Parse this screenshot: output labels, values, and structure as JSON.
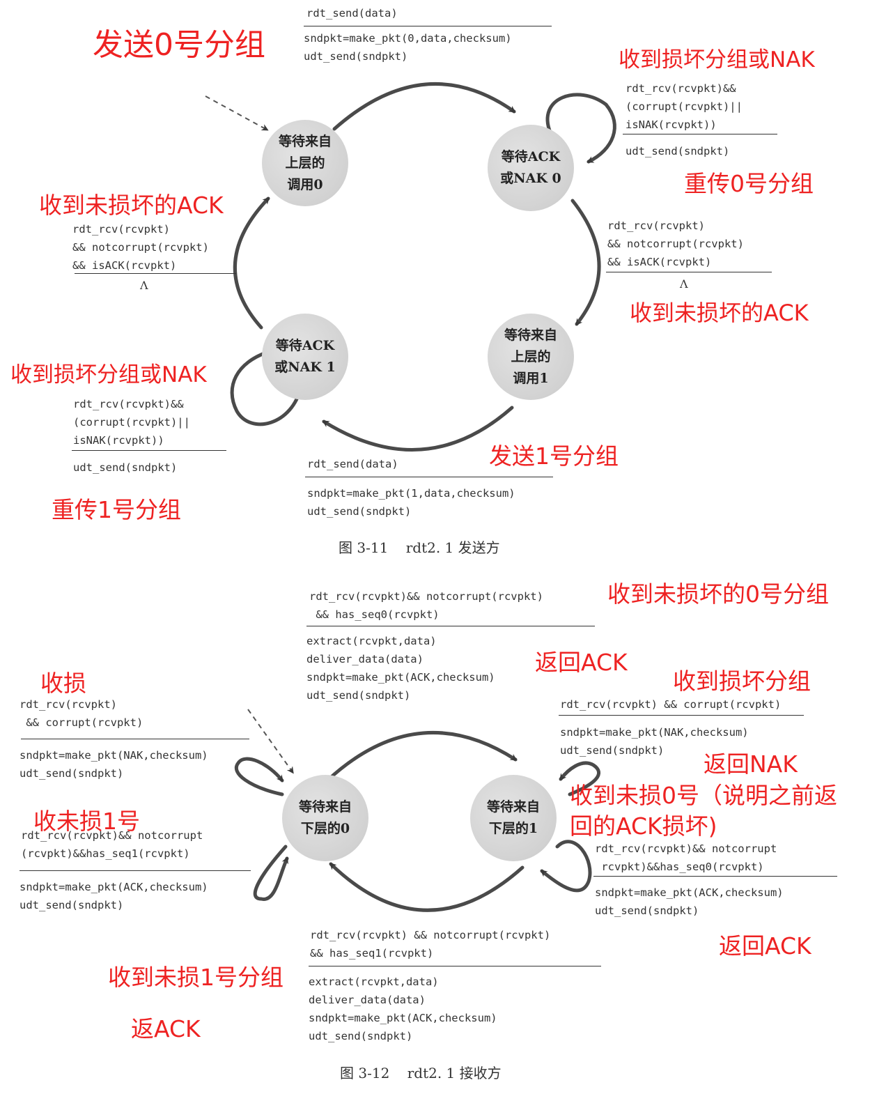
{
  "sender": {
    "caption": "图 3-11    rdt2. 1 发送方",
    "states": {
      "wait_call_0": "等待来自\n上层的\n调用0",
      "wait_ack_0": "等待ACK\n或NAK 0",
      "wait_call_1": "等待来自\n上层的\n调用1",
      "wait_ack_1": "等待ACK\n或NAK 1"
    },
    "transitions": {
      "send0": {
        "event": "rdt_send(data)",
        "actions": "sndpkt=make_pkt(0,data,checksum)\nudt_send(sndpkt)"
      },
      "resend0": {
        "event": "rdt_rcv(rcvpkt)&&\n(corrupt(rcvpkt)||\nisNAK(rcvpkt))",
        "actions": "udt_send(sndpkt)"
      },
      "ack0": {
        "event": "rdt_rcv(rcvpkt)\n&& notcorrupt(rcvpkt)\n&& isACK(rcvpkt)",
        "actions": "Λ"
      },
      "send1": {
        "event": "rdt_send(data)",
        "actions": "sndpkt=make_pkt(1,data,checksum)\nudt_send(sndpkt)"
      },
      "resend1": {
        "event": "rdt_rcv(rcvpkt)&&\n(corrupt(rcvpkt)||\nisNAK(rcvpkt))",
        "actions": "udt_send(sndpkt)"
      },
      "ack1": {
        "event": "rdt_rcv(rcvpkt)\n&& notcorrupt(rcvpkt)\n&& isACK(rcvpkt)",
        "actions": "Λ"
      }
    },
    "notes": {
      "send0": "发送0号分组",
      "corrupt_nak_top": "收到损坏分组或NAK",
      "resend0": "重传0号分组",
      "ack_left": "收到未损坏的ACK",
      "ack_right": "收到未损坏的ACK",
      "corrupt_nak_left": "收到损坏分组或NAK",
      "send1": "发送1号分组",
      "resend1": "重传1号分组"
    }
  },
  "receiver": {
    "caption": "图 3-12    rdt2. 1 接收方",
    "states": {
      "wait_below_0": "等待来自\n下层的0",
      "wait_below_1": "等待来自\n下层的1"
    },
    "transitions": {
      "top": {
        "event": "rdt_rcv(rcvpkt)&& notcorrupt(rcvpkt)\n && has_seq0(rcvpkt)",
        "actions": "extract(rcvpkt,data)\ndeliver_data(data)\nsndpkt=make_pkt(ACK,checksum)\nudt_send(sndpkt)"
      },
      "left_corrupt": {
        "event": "rdt_rcv(rcvpkt)\n && corrupt(rcvpkt)",
        "actions": "sndpkt=make_pkt(NAK,checksum)\nudt_send(sndpkt)"
      },
      "left_seq1": {
        "event": "rdt_rcv(rcvpkt)&& notcorrupt\n(rcvpkt)&&has_seq1(rcvpkt)",
        "actions": "sndpkt=make_pkt(ACK,checksum)\nudt_send(sndpkt)"
      },
      "right_corrupt": {
        "event": "rdt_rcv(rcvpkt) && corrupt(rcvpkt)",
        "actions": "sndpkt=make_pkt(NAK,checksum)\nudt_send(sndpkt)"
      },
      "right_seq0": {
        "event": "rdt_rcv(rcvpkt)&& notcorrupt\n rcvpkt)&&has_seq0(rcvpkt)",
        "actions": "sndpkt=make_pkt(ACK,checksum)\nudt_send(sndpkt)"
      },
      "bottom": {
        "event": "rdt_rcv(rcvpkt) && notcorrupt(rcvpkt)\n&& has_seq1(rcvpkt)",
        "actions": "extract(rcvpkt,data)\ndeliver_data(data)\nsndpkt=make_pkt(ACK,checksum)\nudt_send(sndpkt)"
      }
    },
    "notes": {
      "top_right": "收到未损坏的0号分组",
      "return_ack_top": "返回ACK",
      "left_corrupt": "收损",
      "right_corrupt": "收到损坏分组",
      "return_nak": "返回NAK",
      "left_seq1": "收未损1号",
      "right_seq0": "收到未损0号（说明之前返\n回的ACK损坏)",
      "return_ack_right": "返回ACK",
      "bottom_left": "收到未损1号分组",
      "return_ack_bottom": "返ACK"
    }
  }
}
